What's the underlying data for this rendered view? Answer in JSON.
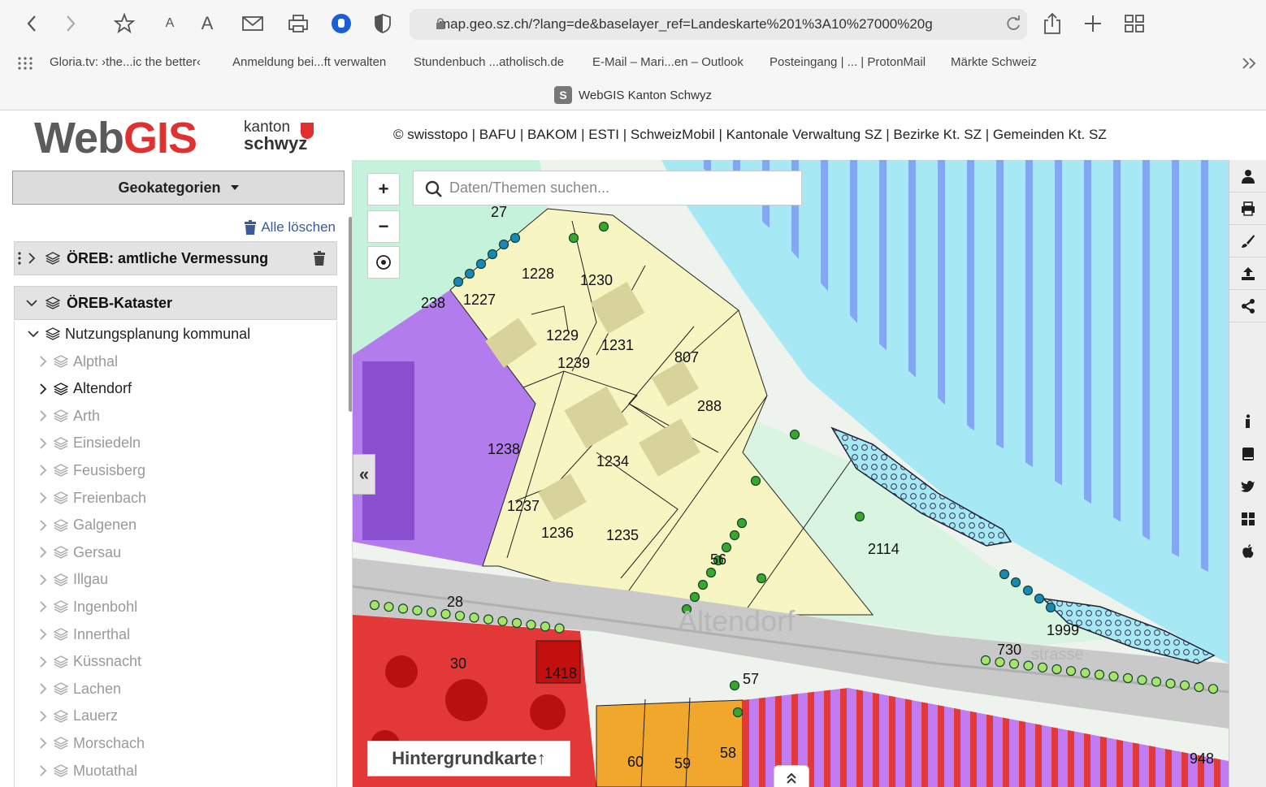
{
  "browser": {
    "url": "map.geo.sz.ch/?lang=de&baselayer_ref=Landeskarte%201%3A10%27000%20g",
    "tab_title": "WebGIS Kanton Schwyz",
    "tab_favicon": "S",
    "bookmarks": [
      "Gloria.tv: ›the...ic the better‹",
      "Anmeldung bei...ft verwalten",
      "Stundenbuch ...atholisch.de",
      "E-Mail – Mari...en – Outlook",
      "Posteingang | ... | ProtonMail",
      "Märkte Schweiz"
    ],
    "font_small": "A",
    "font_large": "A"
  },
  "header": {
    "logo_web": "Web",
    "logo_gis": "GIS",
    "logo_kanton": "kanton",
    "logo_schwyz": "schwyz",
    "attribution": "© swisstopo | BAFU | BAKOM | ESTI | SchweizMobil | Kantonale Verwaltung SZ | Bezirke Kt. SZ | Gemeinden Kt. SZ"
  },
  "sidebar": {
    "geokategorien_label": "Geokategorien",
    "clear_all_label": "Alle löschen",
    "layer_panels": [
      {
        "title": "ÖREB: amtliche Vermessung"
      },
      {
        "title": "ÖREB-Kataster"
      }
    ],
    "group_label": "Nutzungsplanung kommunal",
    "municipalities": [
      "Alpthal",
      "Altendorf",
      "Arth",
      "Einsiedeln",
      "Feusisberg",
      "Freienbach",
      "Galgenen",
      "Gersau",
      "Illgau",
      "Ingenbohl",
      "Innerthal",
      "Küssnacht",
      "Lachen",
      "Lauerz",
      "Morschach",
      "Muotathal"
    ],
    "active_municipality": "Altendorf"
  },
  "map": {
    "search_placeholder": "Daten/Themen suchen...",
    "zoom_in": "+",
    "zoom_out": "−",
    "collapse_label": "«",
    "basemap_label": "Hintergrundkarte↑",
    "expand_label": "⌃",
    "place_label": "Altendorf",
    "street_label": "strasse",
    "parcels": [
      "27",
      "238",
      "1227",
      "1228",
      "1230",
      "1229",
      "1231",
      "1239",
      "807",
      "288",
      "1238",
      "1234",
      "1237",
      "1236",
      "1235",
      "56",
      "2114",
      "28",
      "1999",
      "730",
      "30",
      "1418",
      "57",
      "60",
      "59",
      "58",
      "948"
    ],
    "colors": {
      "lake": "#a6e9f5",
      "lake_stripes": "#7d9cf3",
      "residential": "#f7f5c2",
      "green_zone": "#c5f2da",
      "green_light": "#d9f5e2",
      "industrial": "#b37cec",
      "core_zone": "#e23838",
      "commercial": "#f1a72b",
      "road": "#c9c9c9"
    }
  },
  "right_toolbar": {
    "icons": [
      "user-icon",
      "print-icon",
      "brush-icon",
      "upload-icon",
      "share-icon",
      "info-icon",
      "book-icon",
      "twitter-icon",
      "windows-icon",
      "apple-icon"
    ]
  }
}
